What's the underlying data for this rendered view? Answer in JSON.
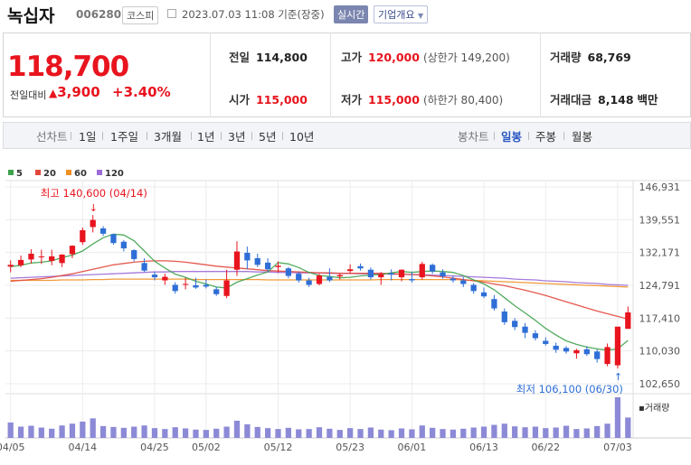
{
  "header": {
    "company_name": "녹십자",
    "stock_code": "006280",
    "market": "코스피",
    "timestamp": "2023.07.03 11:08 기준(장중)",
    "realtime_label": "실시간",
    "overview_label": "기업개요"
  },
  "price": {
    "current": "118,700",
    "change_label": "전일대비",
    "change_amount": "3,900",
    "change_percent": "+3.40%"
  },
  "stats": [
    {
      "label": "전일",
      "value": "114,800",
      "sub": "",
      "color": "black"
    },
    {
      "label": "고가",
      "value": "120,000",
      "sub": "(상한가 149,200)",
      "color": "red"
    },
    {
      "label": "거래량",
      "value": "68,769",
      "sub": "",
      "color": "black"
    },
    {
      "label": "시가",
      "value": "115,000",
      "sub": "",
      "color": "red"
    },
    {
      "label": "저가",
      "value": "115,000",
      "sub": "(하한가 80,400)",
      "color": "red"
    },
    {
      "label": "거래대금",
      "value": "8,148",
      "sub": "백만",
      "color": "black"
    }
  ],
  "toolbar": {
    "line_label": "선차트",
    "line_periods": [
      "1일",
      "1주일",
      "3개월",
      "1년",
      "3년",
      "5년",
      "10년"
    ],
    "candle_label": "봉차트",
    "candle_periods": [
      "일봉",
      "주봉",
      "월봉"
    ],
    "active_candle_period": "일봉"
  },
  "chart_data": {
    "type": "candlestick",
    "ma_legend": [
      {
        "name": "5",
        "color": "#3fa34d"
      },
      {
        "name": "20",
        "color": "#e2473b"
      },
      {
        "name": "60",
        "color": "#ef8f22"
      },
      {
        "name": "120",
        "color": "#9b6bd6"
      }
    ],
    "y_ticks": [
      146931,
      139551,
      132171,
      124791,
      117410,
      110030,
      102650
    ],
    "y_tick_labels": [
      "146,931",
      "139,551",
      "132,171",
      "124,791",
      "117,410",
      "110,030",
      "102,650"
    ],
    "ylim": [
      102650,
      146931
    ],
    "x_tick_labels": [
      "04/05",
      "04/14",
      "04/25",
      "05/02",
      "05/12",
      "05/23",
      "06/01",
      "06/13",
      "06/22",
      "07/03"
    ],
    "x_tick_index": [
      0,
      7,
      14,
      19,
      26,
      33,
      39,
      46,
      52,
      59
    ],
    "high_annotation": "최고 140,600 (04/14)",
    "low_annotation": "최저 106,100 (06/30)",
    "volume_label": "거래량",
    "colors": {
      "up": "#e8141e",
      "down": "#2e6ed6"
    },
    "candles": [
      [
        129000,
        130400,
        127700,
        129400
      ],
      [
        129300,
        131500,
        128900,
        130500
      ],
      [
        130600,
        132900,
        129700,
        131900
      ],
      [
        131300,
        132800,
        129600,
        131300
      ],
      [
        130300,
        132800,
        129300,
        131300
      ],
      [
        129800,
        131800,
        128900,
        131700
      ],
      [
        131800,
        133800,
        130900,
        133700
      ],
      [
        134500,
        137800,
        133900,
        137200
      ],
      [
        137900,
        140600,
        136700,
        139500
      ],
      [
        137600,
        138100,
        135900,
        136400
      ],
      [
        136300,
        136400,
        133900,
        134300
      ],
      [
        134600,
        135000,
        132400,
        133100
      ],
      [
        132700,
        132900,
        130200,
        130700
      ],
      [
        129800,
        130900,
        127800,
        128100
      ],
      [
        127200,
        127900,
        125900,
        126600
      ],
      [
        125900,
        127400,
        124900,
        126700
      ],
      [
        124900,
        125500,
        122900,
        123500
      ],
      [
        124900,
        126500,
        123900,
        125100
      ],
      [
        124800,
        126500,
        124000,
        124300
      ],
      [
        124900,
        126100,
        124100,
        124500
      ],
      [
        123900,
        124500,
        122400,
        122800
      ],
      [
        122400,
        128300,
        121900,
        125900
      ],
      [
        128300,
        134700,
        126900,
        132400
      ],
      [
        132100,
        133500,
        128400,
        130400
      ],
      [
        130900,
        131900,
        128900,
        129400
      ],
      [
        129900,
        130900,
        127900,
        128400
      ],
      [
        128900,
        130200,
        127600,
        129200
      ],
      [
        128600,
        128900,
        126400,
        126900
      ],
      [
        127400,
        127900,
        125400,
        125900
      ],
      [
        125900,
        126500,
        124400,
        124900
      ],
      [
        125100,
        127400,
        124800,
        127000
      ],
      [
        126700,
        128600,
        125500,
        125900
      ],
      [
        126800,
        127500,
        126100,
        127100
      ],
      [
        128000,
        129500,
        127500,
        128400
      ],
      [
        129100,
        129700,
        128100,
        128600
      ],
      [
        128300,
        128800,
        126100,
        126600
      ],
      [
        126600,
        127800,
        124900,
        127300
      ],
      [
        127500,
        128400,
        125900,
        127200
      ],
      [
        126600,
        128400,
        125700,
        128300
      ],
      [
        126200,
        127900,
        125400,
        125900
      ],
      [
        126600,
        130100,
        126100,
        129600
      ],
      [
        129400,
        129700,
        127400,
        127900
      ],
      [
        127700,
        128400,
        126300,
        126800
      ],
      [
        126300,
        126900,
        125400,
        125900
      ],
      [
        125900,
        126600,
        124400,
        125100
      ],
      [
        124900,
        125300,
        122900,
        123500
      ],
      [
        123200,
        124300,
        121900,
        122300
      ],
      [
        121700,
        122600,
        119100,
        119600
      ],
      [
        118900,
        119600,
        115900,
        116500
      ],
      [
        116800,
        117400,
        114700,
        115400
      ],
      [
        115500,
        116300,
        112900,
        114100
      ],
      [
        114000,
        114700,
        112400,
        112900
      ],
      [
        112300,
        113100,
        111200,
        111600
      ],
      [
        111200,
        111900,
        109600,
        110300
      ],
      [
        110700,
        111100,
        109400,
        109900
      ],
      [
        109500,
        110500,
        108300,
        110200
      ],
      [
        110400,
        111100,
        108900,
        109300
      ],
      [
        109900,
        110400,
        107400,
        108200
      ],
      [
        107100,
        111700,
        106600,
        110900
      ],
      [
        106800,
        112900,
        106100,
        115500
      ],
      [
        115000,
        120000,
        115000,
        118700
      ]
    ],
    "ma5": [
      129000,
      129300,
      129800,
      130000,
      130300,
      131000,
      131600,
      132500,
      134100,
      135500,
      136300,
      136100,
      134800,
      132500,
      130200,
      128700,
      127300,
      126600,
      125700,
      125100,
      124400,
      124200,
      125500,
      126300,
      127100,
      127800,
      129900,
      129600,
      128800,
      127700,
      127000,
      126800,
      126500,
      126600,
      126900,
      127100,
      127200,
      127600,
      127900,
      127700,
      127900,
      128000,
      127900,
      127700,
      127000,
      126000,
      125100,
      123800,
      122000,
      120200,
      118600,
      116900,
      115100,
      113600,
      112300,
      111500,
      110900,
      110500,
      110200,
      110500,
      112400
    ],
    "ma20": [
      125700,
      125900,
      126100,
      126300,
      126600,
      127000,
      127400,
      127900,
      128400,
      128900,
      129400,
      129700,
      130000,
      130200,
      130300,
      130300,
      130200,
      130000,
      129700,
      129400,
      129100,
      128900,
      128700,
      128500,
      128300,
      128100,
      128000,
      127900,
      127800,
      127700,
      127600,
      127600,
      127500,
      127500,
      127500,
      127500,
      127500,
      127400,
      127300,
      127200,
      127100,
      126900,
      126700,
      126400,
      126100,
      125800,
      125500,
      125100,
      124700,
      124200,
      123700,
      123100,
      122500,
      121800,
      121100,
      120400,
      119700,
      119000,
      118400,
      117800,
      117200
    ],
    "ma60": [
      125900,
      125900,
      125900,
      125900,
      125900,
      126000,
      126000,
      126000,
      126100,
      126100,
      126200,
      126200,
      126200,
      126200,
      126200,
      126200,
      126200,
      126200,
      126100,
      126100,
      126100,
      126100,
      126100,
      126100,
      126100,
      126000,
      126000,
      126000,
      126000,
      126000,
      126000,
      126000,
      126000,
      126000,
      126000,
      126000,
      126100,
      126100,
      126100,
      126100,
      126100,
      126100,
      126100,
      126100,
      126000,
      125900,
      125800,
      125700,
      125600,
      125500,
      125400,
      125300,
      125200,
      125100,
      125000,
      124900,
      124800,
      124700,
      124600,
      124500,
      124400
    ],
    "ma120": [
      126400,
      126500,
      126600,
      126700,
      126800,
      126900,
      127000,
      127100,
      127200,
      127300,
      127400,
      127500,
      127600,
      127700,
      127800,
      127800,
      127900,
      127900,
      127900,
      127900,
      127900,
      127900,
      127900,
      127900,
      127800,
      127800,
      127700,
      127700,
      127600,
      127600,
      127600,
      127500,
      127500,
      127500,
      127400,
      127400,
      127400,
      127300,
      127300,
      127200,
      127200,
      127100,
      127000,
      126900,
      126800,
      126700,
      126600,
      126500,
      126400,
      126200,
      126100,
      126000,
      125800,
      125700,
      125600,
      125400,
      125300,
      125200,
      125000,
      124900,
      124800
    ],
    "volume": [
      52000,
      38000,
      41000,
      35000,
      31000,
      42000,
      48000,
      55000,
      66000,
      40000,
      37000,
      34000,
      38000,
      42000,
      33000,
      30000,
      36000,
      32000,
      28000,
      27000,
      31000,
      38000,
      58000,
      46000,
      37000,
      33000,
      30000,
      34000,
      29000,
      30000,
      36000,
      31000,
      27000,
      33000,
      30000,
      35000,
      28000,
      26000,
      32000,
      29000,
      42000,
      34000,
      30000,
      28000,
      31000,
      35000,
      38000,
      44000,
      48000,
      39000,
      36000,
      38000,
      33000,
      35000,
      41000,
      30000,
      32000,
      40000,
      48000,
      137000,
      68769
    ]
  }
}
